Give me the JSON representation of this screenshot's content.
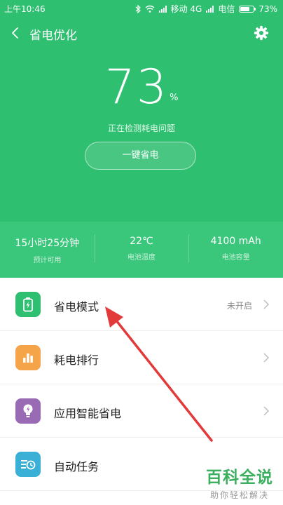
{
  "status_bar": {
    "time": "上午10:46",
    "carrier_1": "移动 4G",
    "carrier_2": "电信",
    "battery_text": "73%",
    "battery_level": 0.73
  },
  "header": {
    "title": "省电优化"
  },
  "battery": {
    "percent": "73",
    "percent_sign": "%",
    "detecting_text": "正在检测耗电问题",
    "one_key_button": "一键省电"
  },
  "stats": [
    {
      "value": "15小时25分钟",
      "label": "预计可用"
    },
    {
      "value": "22℃",
      "label": "电池温度"
    },
    {
      "value": "4100 mAh",
      "label": "电池容量"
    }
  ],
  "list": [
    {
      "label": "省电模式",
      "status": "未开启",
      "icon": "battery-mode-icon",
      "color": "#2fbf71"
    },
    {
      "label": "耗电排行",
      "status": "",
      "icon": "bar-chart-icon",
      "color": "#f5a44a"
    },
    {
      "label": "应用智能省电",
      "status": "",
      "icon": "lightbulb-icon",
      "color": "#9a6bb5"
    },
    {
      "label": "自动任务",
      "status": "",
      "icon": "scheduled-task-icon",
      "color": "#3bb0d6"
    }
  ],
  "watermark": {
    "title": "百科全说",
    "subtitle": "助你轻松解决"
  },
  "colors": {
    "primary_green": "#2fbf71",
    "annotation_arrow": "#e23a3a"
  }
}
